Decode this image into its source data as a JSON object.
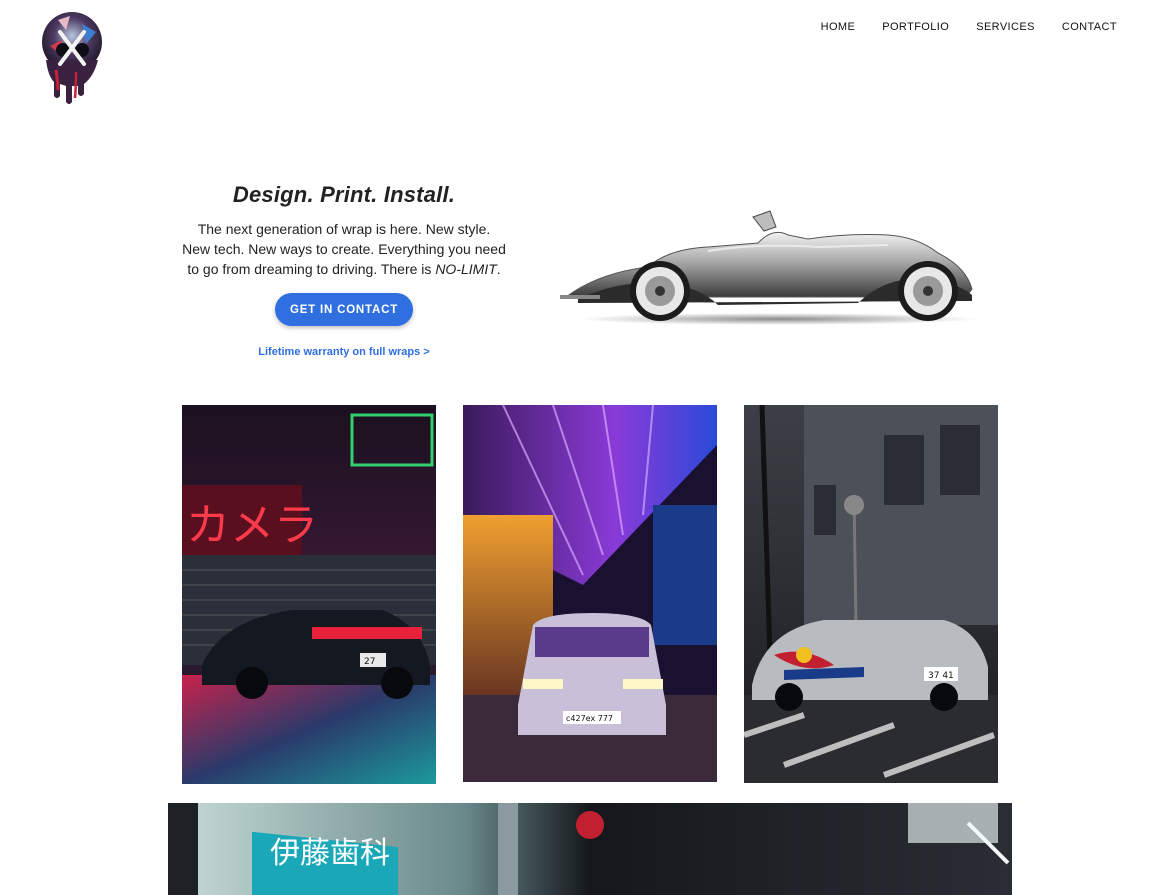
{
  "nav": {
    "items": [
      "HOME",
      "PORTFOLIO",
      "SERVICES",
      "CONTACT"
    ]
  },
  "hero": {
    "title": "Design. Print. Install.",
    "body_line1": "The next generation of wrap is here. New style.",
    "body_line2": "New tech. New ways to create. Everything you need",
    "body_line3_prefix": "to go from dreaming to driving. There is ",
    "body_line3_emphasis": "NO-LIMIT",
    "body_line3_suffix": ".",
    "cta_label": "GET IN CONTACT",
    "warranty_link": "Lifetime warranty on full wraps >"
  },
  "gallery": {
    "photo1_sign": "カメラ",
    "photo1_plate": "27",
    "photo2_plate": "c427ex 777",
    "photo3_plate": "37 41"
  },
  "banner": {
    "sign_text": "伊藤歯科"
  },
  "colors": {
    "accent": "#2f6fdf",
    "text": "#222222",
    "background": "#ffffff"
  },
  "icons": {
    "logo": "dripping-skull-logo"
  }
}
